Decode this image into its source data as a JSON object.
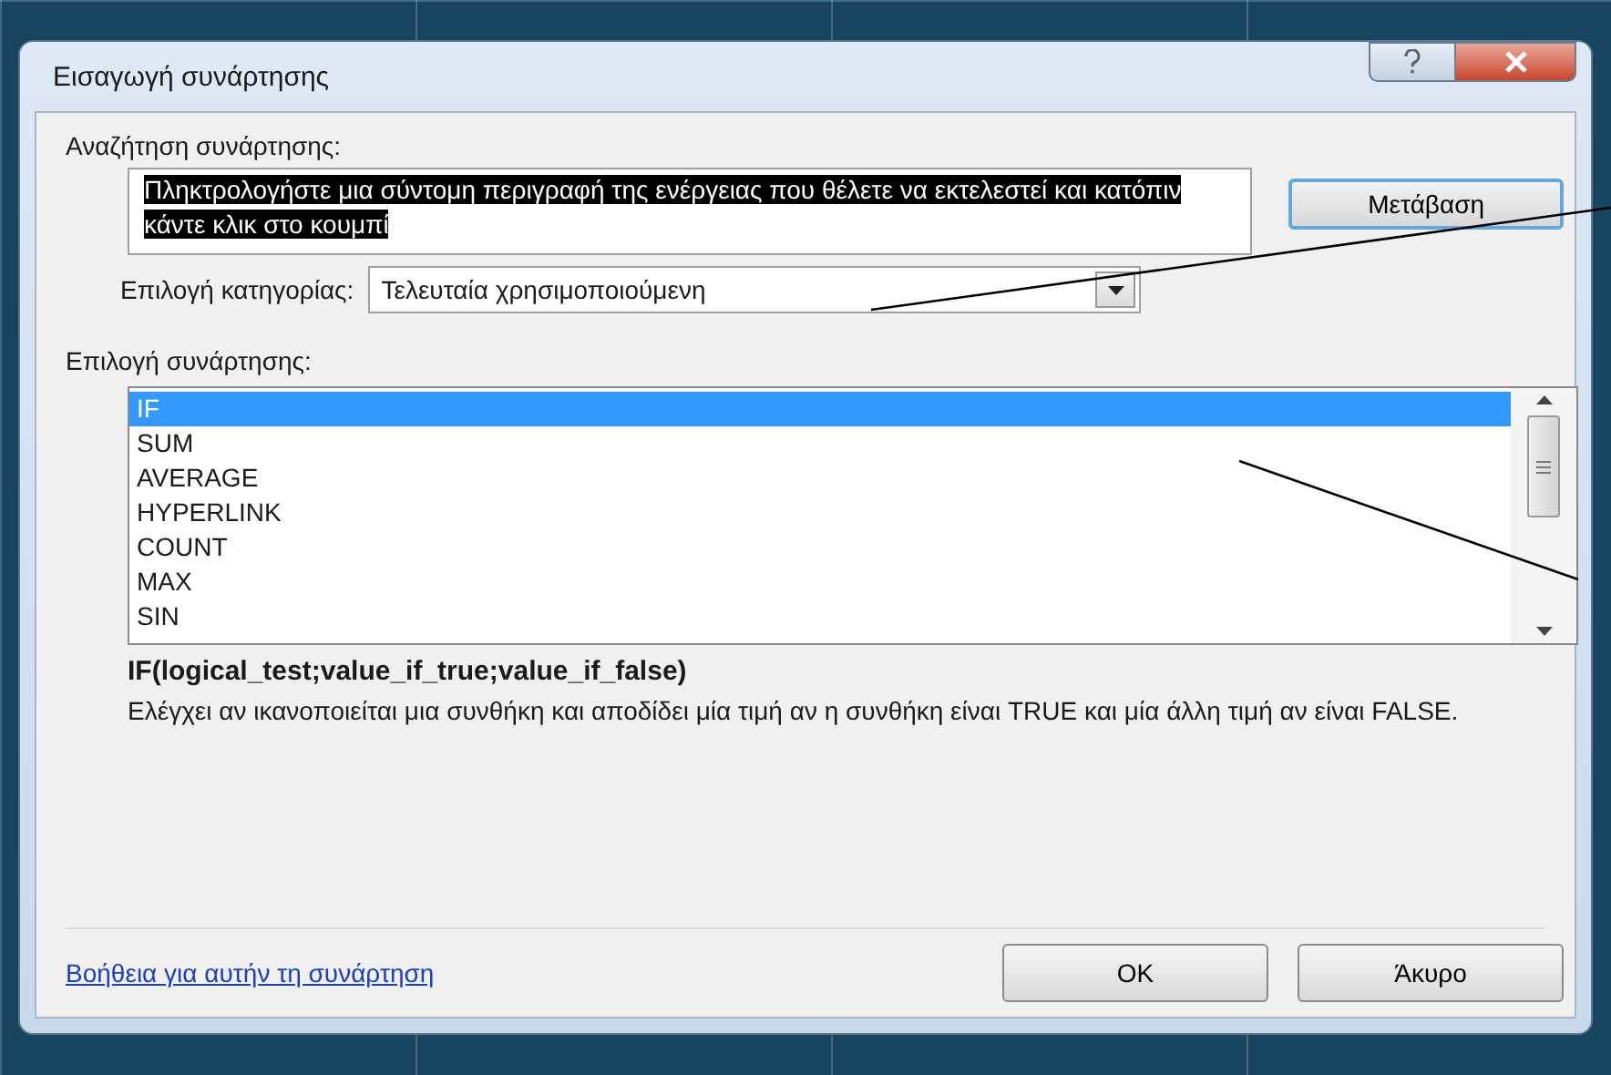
{
  "window": {
    "title": "Εισαγωγή συνάρτησης"
  },
  "search": {
    "label": "Αναζήτηση συνάρτησης:",
    "value": "Πληκτρολογήστε μια σύντομη περιγραφή της ενέργειας που θέλετε να εκτελεστεί και κατόπιν κάντε κλικ στο κουμπί",
    "text_selected": true
  },
  "go_button": "Μετάβαση",
  "category": {
    "label": "Επιλογή κατηγορίας:",
    "value": "Τελευταία χρησιμοποιούμενη"
  },
  "functions": {
    "label": "Επιλογή συνάρτησης:",
    "items": [
      {
        "name": "IF",
        "selected": true
      },
      {
        "name": "SUM",
        "selected": false
      },
      {
        "name": "AVERAGE",
        "selected": false
      },
      {
        "name": "HYPERLINK",
        "selected": false
      },
      {
        "name": "COUNT",
        "selected": false
      },
      {
        "name": "MAX",
        "selected": false
      },
      {
        "name": "SIN",
        "selected": false
      }
    ]
  },
  "signature": "IF(logical_test;value_if_true;value_if_false)",
  "description": "Ελέγχει αν ικανοποιείται μια συνθήκη και αποδίδει μία τιμή αν η συνθήκη είναι TRUE και μία άλλη τιμή αν είναι FALSE.",
  "help_link": "Βοήθεια για αυτήν τη συνάρτηση",
  "buttons": [
    "OK",
    "Άκυρο"
  ]
}
